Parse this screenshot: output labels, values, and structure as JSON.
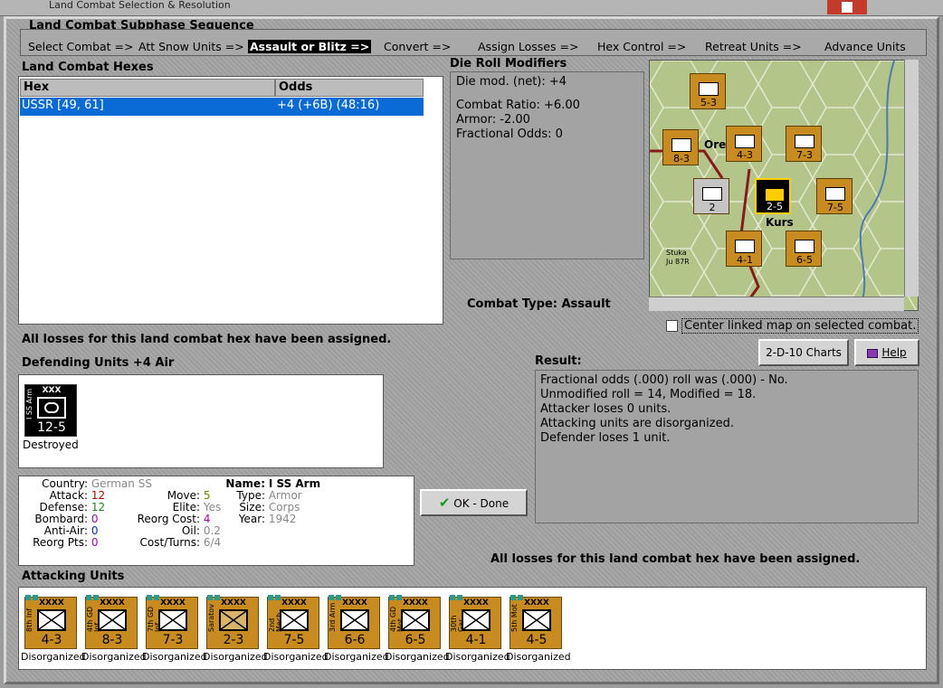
{
  "window": {
    "title": "Land Combat Selection & Resolution",
    "flag_symbol": "卐"
  },
  "sequence": {
    "title": "Land Combat Subphase Sequence",
    "steps": [
      "Select Combat =>",
      "Att Snow Units =>",
      "Assault or Blitz =>",
      "Convert =>",
      "Assign Losses =>",
      "Hex Control =>",
      "Retreat Units =>",
      "Advance Units"
    ],
    "active_index": 2
  },
  "hexes": {
    "title": "Land Combat Hexes",
    "columns": [
      "Hex",
      "Odds"
    ],
    "rows": [
      {
        "hex": "USSR [49, 61]",
        "odds": "+4 (+6B) (48:16)"
      }
    ]
  },
  "modifiers": {
    "title": "Die Roll Modifiers",
    "net": "Die mod. (net): +4",
    "ratio": "Combat Ratio: +6.00",
    "armor": "Armor: -2.00",
    "fractional": "Fractional Odds: 0"
  },
  "combat_type": {
    "label": "Combat Type:",
    "value": "Assault"
  },
  "center_map": {
    "label": "Center linked map on selected combat.",
    "checked": false
  },
  "buttons": {
    "charts": "2-D-10 Charts",
    "help": "Help",
    "ok": "OK - Done"
  },
  "losses_msg": "All losses for this land combat hex have been assigned.",
  "defending": {
    "title": "Defending Units +4 Air",
    "units": [
      {
        "name": "I SS Arm",
        "size": "XXX",
        "value": "12-5",
        "status": "Destroyed"
      }
    ]
  },
  "result": {
    "title": "Result:",
    "lines": [
      "Fractional odds (.000) roll was (.000)  - No.",
      "Unmodified roll = 14, Modified = 18.",
      "Attacker loses 0 units.",
      "Attacking units are disorganized.",
      "Defender loses 1 unit."
    ]
  },
  "unit_info": {
    "country_lbl": "Country:",
    "country": "German SS",
    "attack_lbl": "Attack:",
    "attack": "12",
    "defense_lbl": "Defense:",
    "defense": "12",
    "bombard_lbl": "Bombard:",
    "bombard": "0",
    "antiair_lbl": "Anti-Air:",
    "antiair": "0",
    "reorgpts_lbl": "Reorg Pts:",
    "reorgpts": "0",
    "move_lbl": "Move:",
    "move": "5",
    "elite_lbl": "Elite:",
    "elite": "Yes",
    "reorgcost_lbl": "Reorg Cost:",
    "reorgcost": "4",
    "oil_lbl": "Oil:",
    "oil": "0.2",
    "costturns_lbl": "Cost/Turns:",
    "costturns": "6/4",
    "name_lbl": "Name:",
    "name": "I SS Arm",
    "type_lbl": "Type:",
    "type": "Armor",
    "size_lbl": "Size:",
    "size": "Corps",
    "year_lbl": "Year:",
    "year": "1942"
  },
  "attacking": {
    "title": "Attacking Units",
    "units": [
      {
        "name": "8th Inf",
        "size": "XXXX",
        "value": "4-3",
        "status": "Disorganized"
      },
      {
        "name": "4th GD Inf",
        "size": "XXXX",
        "value": "8-3",
        "status": "Disorganized"
      },
      {
        "name": "7th GD Inf",
        "size": "XXXX",
        "value": "7-3",
        "status": "Disorganized"
      },
      {
        "name": "Saratov",
        "size": "XXXX",
        "value": "2-3",
        "status": "Disorganized"
      },
      {
        "name": "2nd Mech",
        "size": "XXXX",
        "value": "7-5",
        "status": "Disorganized"
      },
      {
        "name": "3rd Arm",
        "size": "XXXX",
        "value": "6-6",
        "status": "Disorganized"
      },
      {
        "name": "4th GD Mot",
        "size": "XXXX",
        "value": "6-5",
        "status": "Disorganized"
      },
      {
        "name": "30th Gar",
        "size": "XXXX",
        "value": "4-1",
        "status": "Disorganized"
      },
      {
        "name": "5th Mot",
        "size": "XXXX",
        "value": "4-5",
        "status": "Disorganized"
      }
    ]
  },
  "map": {
    "counters": [
      "5-3",
      "8-3",
      "4-3",
      "7-3",
      "2",
      "7-5",
      "4-1",
      "6-5",
      "2-5"
    ],
    "labels": [
      "Ore",
      "Kurs",
      "Ju 87R",
      "Stuka"
    ]
  },
  "colors": {
    "accent": "#0a6ad6",
    "counter": "#c78b1f",
    "red": "#c00000",
    "green": "#1a8a1a",
    "purple": "#b000b0"
  }
}
